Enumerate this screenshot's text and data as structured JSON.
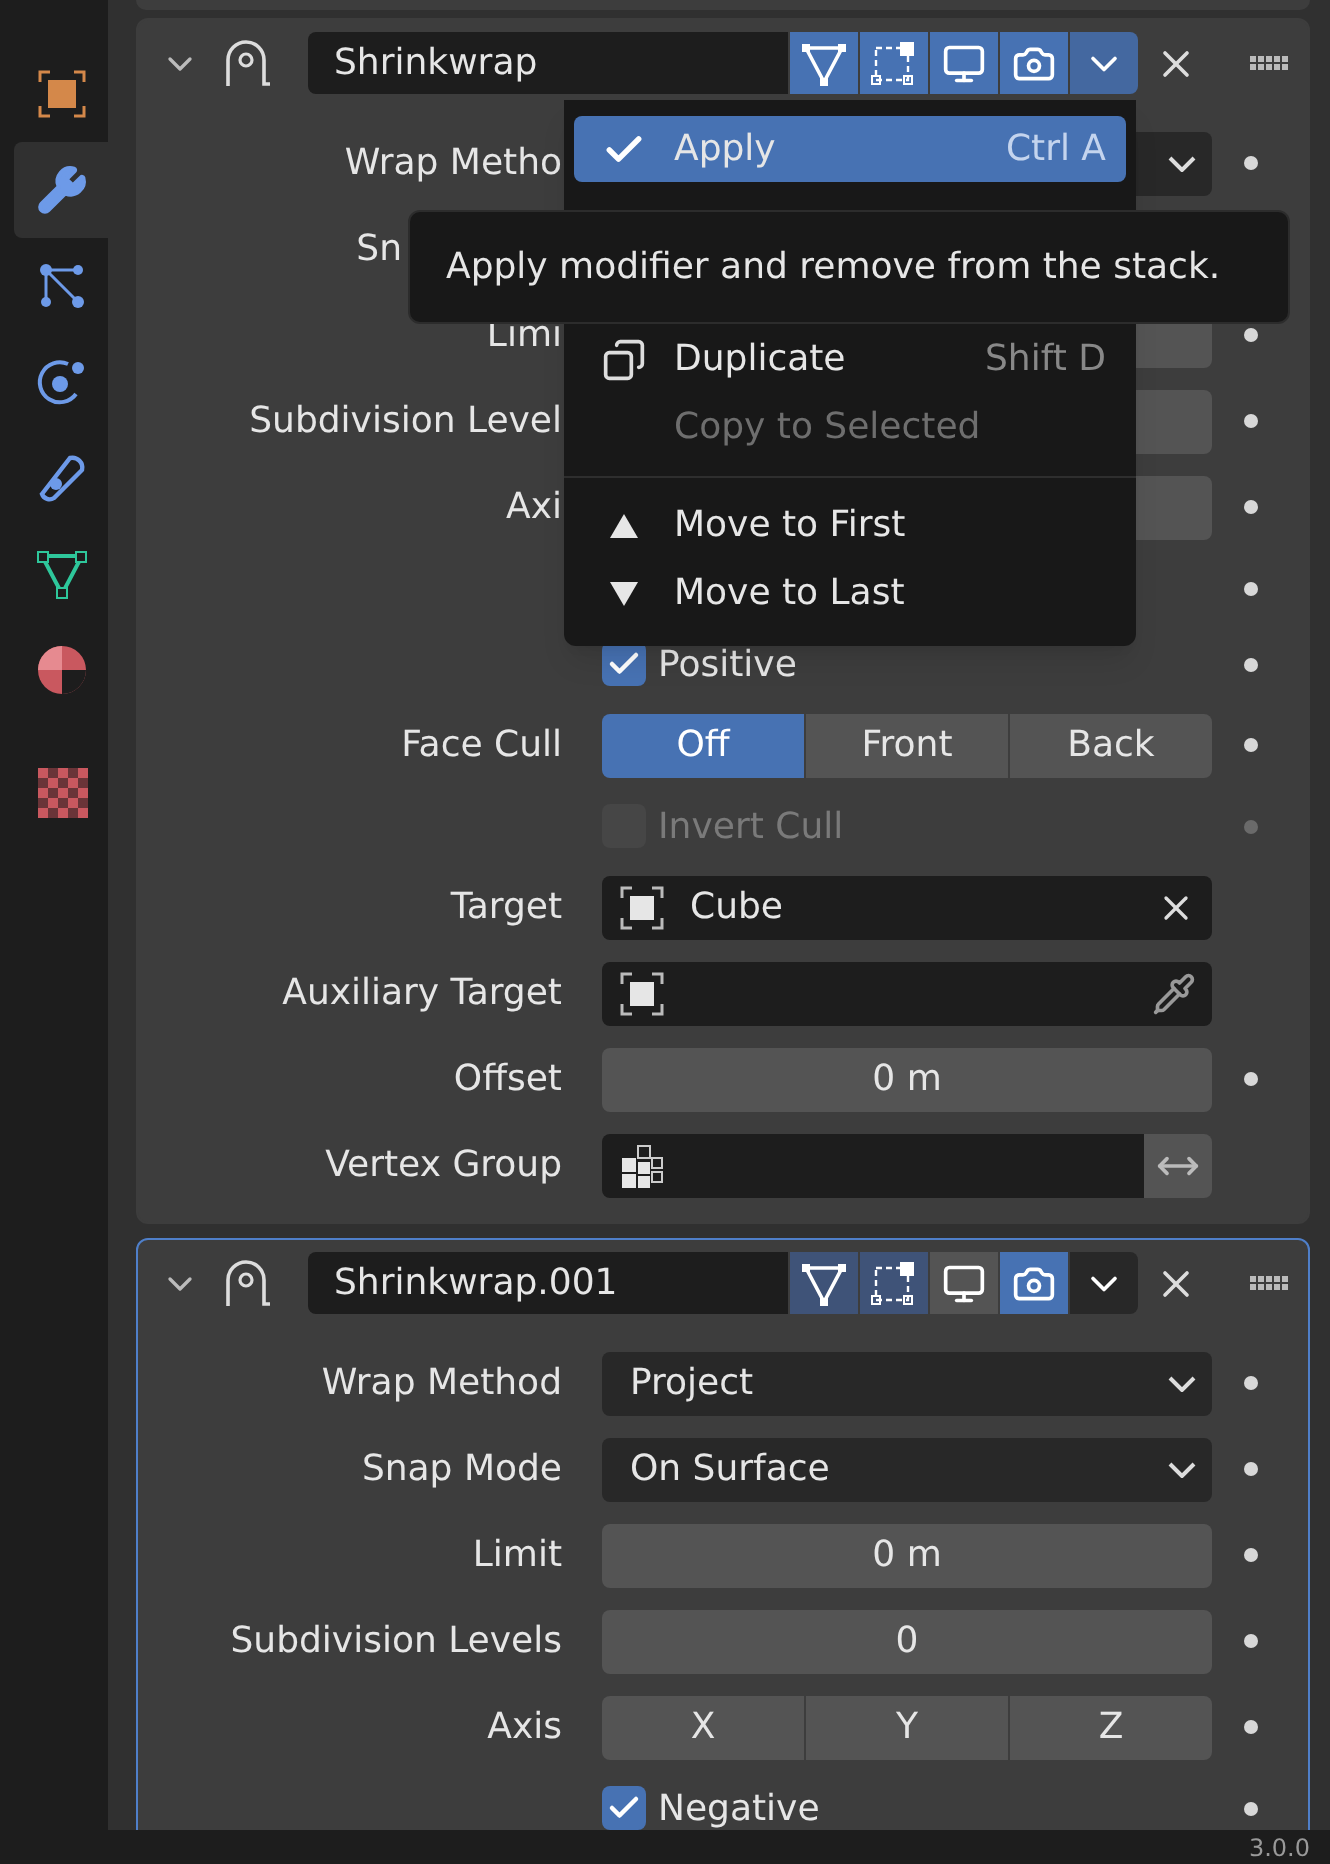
{
  "sidebar": {
    "tabs": [
      {
        "kind": "object",
        "selected": false
      },
      {
        "kind": "modifier",
        "selected": true
      },
      {
        "kind": "particles",
        "selected": false
      },
      {
        "kind": "physics",
        "selected": false
      },
      {
        "kind": "constraints",
        "selected": false
      },
      {
        "kind": "data",
        "selected": false
      },
      {
        "kind": "material",
        "selected": false
      },
      {
        "kind": "texture",
        "selected": false
      }
    ]
  },
  "panels": [
    {
      "name": "Shrinkwrap",
      "expanded": true,
      "active": false,
      "menu_open": true,
      "toggles": [
        {
          "kind": "editmode",
          "on": true,
          "enabled": true
        },
        {
          "kind": "cage",
          "on": true,
          "enabled": true
        },
        {
          "kind": "viewport",
          "on": true,
          "enabled": true
        },
        {
          "kind": "render",
          "on": true,
          "enabled": true
        }
      ],
      "rows": [
        {
          "kind": "dropdown",
          "label": "Wrap Metho",
          "dot": true
        },
        {
          "kind": "covered",
          "label": "Sn",
          "under_tooltip": true,
          "dot": false
        },
        {
          "kind": "number",
          "label": "Limi",
          "dot": true
        },
        {
          "kind": "number",
          "label": "Subdivision Level",
          "dot": true
        },
        {
          "kind": "segmented",
          "label": "Axi",
          "options": [],
          "dot": true
        },
        {
          "kind": "checkbox",
          "dot": true
        },
        {
          "kind": "checkbox",
          "label": "Positive",
          "checked": true,
          "disabled": false,
          "dot": true
        },
        {
          "kind": "segmented",
          "label": "Face Cull",
          "options": [
            {
              "label": "Off",
              "selected": true
            },
            {
              "label": "Front",
              "selected": false
            },
            {
              "label": "Back",
              "selected": false
            }
          ],
          "dot": true
        },
        {
          "kind": "checkbox",
          "label": "Invert Cull",
          "checked": false,
          "disabled": true,
          "dot": true
        },
        {
          "kind": "object",
          "label": "Target",
          "value": "Cube",
          "dot": false
        },
        {
          "kind": "eyedropper",
          "label": "Auxiliary Target",
          "dot": false
        },
        {
          "kind": "number",
          "label": "Offset",
          "value": "0 m",
          "dot": true
        },
        {
          "kind": "vertex_group",
          "label": "Vertex Group",
          "dot": false
        }
      ]
    },
    {
      "name": "Shrinkwrap.001",
      "expanded": true,
      "active": true,
      "menu_open": false,
      "toggles": [
        {
          "kind": "editmode",
          "on": true,
          "enabled": false
        },
        {
          "kind": "cage",
          "on": true,
          "enabled": false
        },
        {
          "kind": "viewport",
          "on": false,
          "enabled": true
        },
        {
          "kind": "render",
          "on": true,
          "enabled": true
        }
      ],
      "rows": [
        {
          "kind": "dropdown",
          "label": "Wrap Method",
          "value": "Project",
          "dot": true
        },
        {
          "kind": "dropdown",
          "label": "Snap Mode",
          "value": "On Surface",
          "dot": true
        },
        {
          "kind": "number",
          "label": "Limit",
          "value": "0 m",
          "dot": true
        },
        {
          "kind": "number",
          "label": "Subdivision Levels",
          "value": "0",
          "dot": true
        },
        {
          "kind": "segmented",
          "label": "Axis",
          "options": [
            {
              "label": "X",
              "selected": false
            },
            {
              "label": "Y",
              "selected": false
            },
            {
              "label": "Z",
              "selected": false
            }
          ],
          "dot": true
        },
        {
          "kind": "checkbox",
          "label": "Negative",
          "checked": true,
          "disabled": false,
          "dot": true
        }
      ]
    }
  ],
  "menu": {
    "items": [
      {
        "kind": "check",
        "label": "Apply",
        "shortcut": "Ctrl A",
        "selected": true,
        "disabled": false
      },
      {
        "kind": "covered"
      },
      {
        "kind": "covered"
      },
      {
        "kind": "duplicate",
        "label": "Duplicate",
        "shortcut": "Shift D",
        "selected": false,
        "disabled": false
      },
      {
        "kind": "plain",
        "label": "Copy to Selected",
        "selected": false,
        "disabled": true
      },
      {
        "kind": "separator"
      },
      {
        "kind": "up",
        "label": "Move to First",
        "selected": false,
        "disabled": false
      },
      {
        "kind": "down",
        "label": "Move to Last",
        "selected": false,
        "disabled": false
      }
    ]
  },
  "tooltip": {
    "text": "Apply modifier and remove from the stack."
  },
  "status_bar": {
    "version": "3.0.0"
  }
}
